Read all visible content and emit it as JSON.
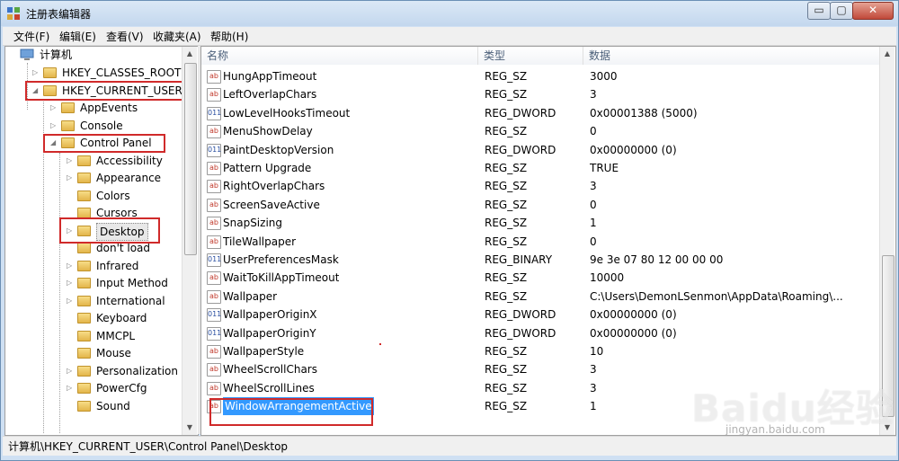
{
  "window": {
    "title": "注册表编辑器",
    "controls": {
      "minimize": "▭",
      "maximize": "▢",
      "close": "✕"
    }
  },
  "menu": [
    "文件(F)",
    "编辑(E)",
    "查看(V)",
    "收藏夹(A)",
    "帮助(H)"
  ],
  "tree": {
    "root": "计算机",
    "nodes": [
      {
        "label": "HKEY_CLASSES_ROOT",
        "expander": "▷"
      },
      {
        "label": "HKEY_CURRENT_USER",
        "expander": "◢"
      },
      {
        "label": "AppEvents",
        "expander": "▷"
      },
      {
        "label": "Console",
        "expander": "▷"
      },
      {
        "label": "Control Panel",
        "expander": "◢"
      },
      {
        "label": "Accessibility",
        "expander": "▷"
      },
      {
        "label": "Appearance",
        "expander": "▷"
      },
      {
        "label": "Colors",
        "expander": ""
      },
      {
        "label": "Cursors",
        "expander": ""
      },
      {
        "label": "Desktop",
        "expander": "▷"
      },
      {
        "label": "don't load",
        "expander": ""
      },
      {
        "label": "Infrared",
        "expander": "▷"
      },
      {
        "label": "Input Method",
        "expander": "▷"
      },
      {
        "label": "International",
        "expander": "▷"
      },
      {
        "label": "Keyboard",
        "expander": ""
      },
      {
        "label": "MMCPL",
        "expander": ""
      },
      {
        "label": "Mouse",
        "expander": ""
      },
      {
        "label": "Personalization",
        "expander": "▷"
      },
      {
        "label": "PowerCfg",
        "expander": "▷"
      },
      {
        "label": "Sound",
        "expander": ""
      }
    ]
  },
  "list": {
    "columns": [
      "名称",
      "类型",
      "数据"
    ],
    "rows": [
      {
        "name": "HungAppTimeout",
        "type": "REG_SZ",
        "data": "3000",
        "icon": "ab"
      },
      {
        "name": "LeftOverlapChars",
        "type": "REG_SZ",
        "data": "3",
        "icon": "ab"
      },
      {
        "name": "LowLevelHooksTimeout",
        "type": "REG_DWORD",
        "data": "0x00001388 (5000)",
        "icon": "011"
      },
      {
        "name": "MenuShowDelay",
        "type": "REG_SZ",
        "data": "0",
        "icon": "ab"
      },
      {
        "name": "PaintDesktopVersion",
        "type": "REG_DWORD",
        "data": "0x00000000 (0)",
        "icon": "011"
      },
      {
        "name": "Pattern Upgrade",
        "type": "REG_SZ",
        "data": "TRUE",
        "icon": "ab"
      },
      {
        "name": "RightOverlapChars",
        "type": "REG_SZ",
        "data": "3",
        "icon": "ab"
      },
      {
        "name": "ScreenSaveActive",
        "type": "REG_SZ",
        "data": "0",
        "icon": "ab"
      },
      {
        "name": "SnapSizing",
        "type": "REG_SZ",
        "data": "1",
        "icon": "ab"
      },
      {
        "name": "TileWallpaper",
        "type": "REG_SZ",
        "data": "0",
        "icon": "ab"
      },
      {
        "name": "UserPreferencesMask",
        "type": "REG_BINARY",
        "data": "9e 3e 07 80 12 00 00 00",
        "icon": "011"
      },
      {
        "name": "WaitToKillAppTimeout",
        "type": "REG_SZ",
        "data": "10000",
        "icon": "ab"
      },
      {
        "name": "Wallpaper",
        "type": "REG_SZ",
        "data": "C:\\Users\\DemonLSenmon\\AppData\\Roaming\\...",
        "icon": "ab"
      },
      {
        "name": "WallpaperOriginX",
        "type": "REG_DWORD",
        "data": "0x00000000 (0)",
        "icon": "011"
      },
      {
        "name": "WallpaperOriginY",
        "type": "REG_DWORD",
        "data": "0x00000000 (0)",
        "icon": "011"
      },
      {
        "name": "WallpaperStyle",
        "type": "REG_SZ",
        "data": "10",
        "icon": "ab"
      },
      {
        "name": "WheelScrollChars",
        "type": "REG_SZ",
        "data": "3",
        "icon": "ab"
      },
      {
        "name": "WheelScrollLines",
        "type": "REG_SZ",
        "data": "3",
        "icon": "ab"
      },
      {
        "name": "WindowArrangementActive",
        "type": "REG_SZ",
        "data": "1",
        "icon": "ab",
        "selected": true
      }
    ]
  },
  "status": "计算机\\HKEY_CURRENT_USER\\Control Panel\\Desktop",
  "watermark": {
    "text": "Baidu经验",
    "sub": "jingyan.baidu.com"
  },
  "colors": {
    "selection": "#3399ff",
    "annotation": "#d02a2a"
  }
}
